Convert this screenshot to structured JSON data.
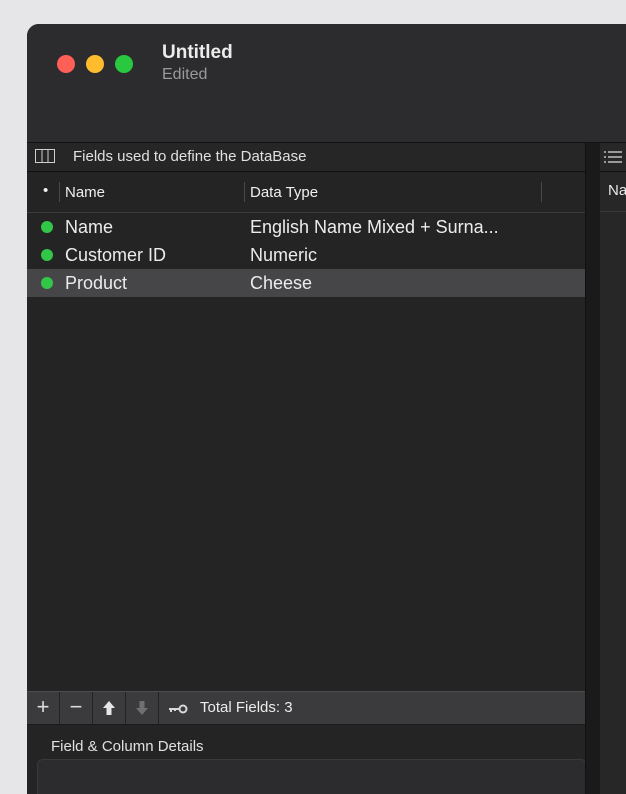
{
  "window": {
    "title": "Untitled",
    "subtitle": "Edited"
  },
  "fields_panel": {
    "header": "Fields used to define the DataBase",
    "columns": {
      "dot": "•",
      "name": "Name",
      "data_type": "Data Type"
    },
    "rows": [
      {
        "name": "Name",
        "data_type": "English Name Mixed + Surna...",
        "status_color": "#33c748"
      },
      {
        "name": "Customer ID",
        "data_type": "Numeric",
        "status_color": "#33c748"
      },
      {
        "name": "Product",
        "data_type": "Cheese",
        "status_color": "#33c748",
        "selected": true
      }
    ]
  },
  "toolbar": {
    "add_label": "+",
    "remove_label": "−",
    "move_up_icon": "arrow-up-icon",
    "move_down_icon": "arrow-down-icon",
    "key_icon": "key-icon",
    "total_fields": "Total Fields: 3"
  },
  "details": {
    "title": "Field & Column Details"
  },
  "right_pane": {
    "column_header": "Na"
  },
  "colors": {
    "status_green": "#33c748",
    "close": "#fe5f57",
    "minimize": "#febc2e",
    "zoom": "#28c840"
  }
}
